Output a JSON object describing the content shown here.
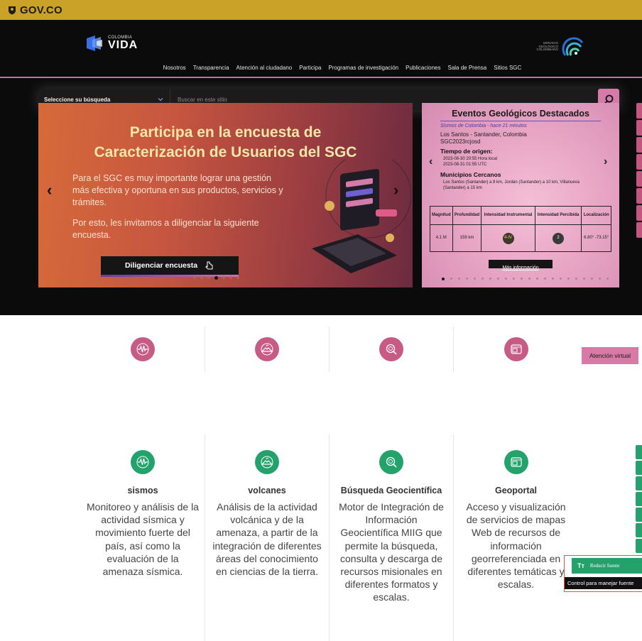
{
  "gov": {
    "brand": "GOV.CO"
  },
  "header": {
    "logo_left_small": "COLOMBIA",
    "logo_left_big": "VIDA",
    "logo_right_text": "SERVICIO GEOLÓGICO COLOMBIANO"
  },
  "nav": {
    "items": [
      "Nosotros",
      "Transparencia",
      "Atención al ciudadano",
      "Participa",
      "Programas de investigación",
      "Publicaciones",
      "Sala de Prensa",
      "Sitios SGC"
    ]
  },
  "search": {
    "select_label": "Seleccione su búsqueda",
    "placeholder": "Buscar en este sitio"
  },
  "banner": {
    "title_line1": "Participa en la encuesta de",
    "title_line2": "Caracterización de Usuarios del SGC",
    "para1": "Para el SGC es muy importante lograr una gestión más efectiva y oportuna en sus productos, servicios y trámites.",
    "para2": "Por esto, les invitamos a diligenciar la siguiente encuesta.",
    "cta": "Diligenciar encuesta"
  },
  "events": {
    "title": "Eventos Geológicos Destacados",
    "meta": "Sismos de Colombia - hace 21 minutos",
    "location": "Los Santos - Santander, Colombia",
    "event_id": "SGC2023rcjosd",
    "origin_label": "Tiempo de origen:",
    "origin_local": "2023-08-30 20:55 Hora local",
    "origin_utc": "2023-08-31 01:55 UTC",
    "municipios_label": "Municipios Cercanos",
    "municipios": "Los Santos (Santander) a 8 km, Jordán (Santander) a 10 km, Villanueva (Santander) a 15 km",
    "table": {
      "headers": [
        "Magnitud",
        "Profundidad",
        "Intensidad Instrumental",
        "Intensidad Percibida",
        "Localización"
      ],
      "magnitud": "4.1 M",
      "profundidad": "159 km",
      "intensidad_instrumental": "4-IV",
      "intensidad_percibida": "2",
      "localizacion": "6.80° -73.15°"
    },
    "more": "Más información"
  },
  "virtual": {
    "label": "Atención virtual"
  },
  "services": [
    {
      "title": "sismos",
      "desc": "Monitoreo y análisis de la actividad sísmica y movimiento fuerte del país, así como la evaluación de la amenaza sísmica."
    },
    {
      "title": "volcanes",
      "desc": "Análisis de la actividad volcánica y de la amenaza, a partir de la integración de diferentes áreas del conocimiento en ciencias de la tierra."
    },
    {
      "title": "Búsqueda Geocientífica",
      "desc": "Motor de Integración de Información Geocientífica MIIG que permite la búsqueda, consulta y descarga de recursos misionales en diferentes formatos y escalas."
    },
    {
      "title": "Geoportal",
      "desc": "Acceso y visualización de servicios de mapas Web de recursos de información georreferenciada en diferentes temáticas y escalas."
    }
  ],
  "fontctl": {
    "button_icon": "Tт",
    "button_label": "Reducir fuente",
    "tooltip": "Control para manejar fuente"
  },
  "colors": {
    "gov_bar": "#c9a227",
    "accent_pink": "#d47ca9",
    "accent_green": "#23a36b"
  }
}
